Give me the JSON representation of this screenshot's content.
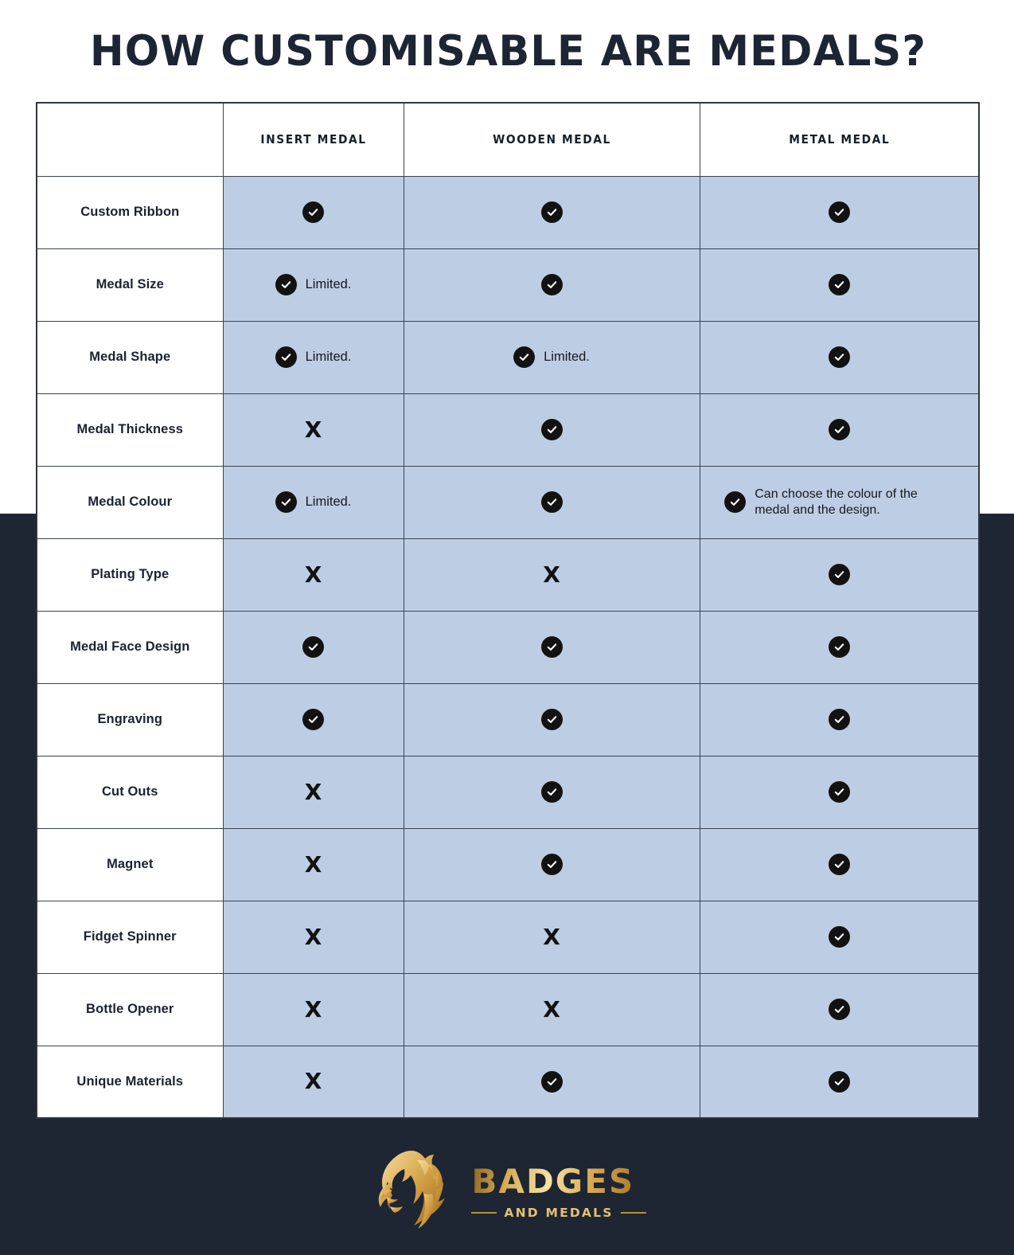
{
  "page": {
    "title": "HOW CUSTOMISABLE ARE MEDALS?",
    "background_light": "#ffffff",
    "background_dark": "#1e2533",
    "cell_highlight": "#bdcee4",
    "accent_gold": "#d8ab52"
  },
  "table": {
    "headers": {
      "label_col": "",
      "columns": [
        "INSERT MEDAL",
        "WOODEN MEDAL",
        "METAL MEDAL"
      ]
    },
    "rows": [
      {
        "label": "Custom Ribbon",
        "cells": [
          {
            "icon": "check-icon",
            "note": ""
          },
          {
            "icon": "check-icon",
            "note": ""
          },
          {
            "icon": "check-icon",
            "note": ""
          }
        ]
      },
      {
        "label": "Medal Size",
        "cells": [
          {
            "icon": "check-icon",
            "note": "Limited."
          },
          {
            "icon": "check-icon",
            "note": ""
          },
          {
            "icon": "check-icon",
            "note": ""
          }
        ]
      },
      {
        "label": "Medal Shape",
        "cells": [
          {
            "icon": "check-icon",
            "note": "Limited."
          },
          {
            "icon": "check-icon",
            "note": "Limited."
          },
          {
            "icon": "check-icon",
            "note": ""
          }
        ]
      },
      {
        "label": "Medal Thickness",
        "cells": [
          {
            "icon": "x-icon",
            "note": ""
          },
          {
            "icon": "check-icon",
            "note": ""
          },
          {
            "icon": "check-icon",
            "note": ""
          }
        ]
      },
      {
        "label": "Medal Colour",
        "cells": [
          {
            "icon": "check-icon",
            "note": "Limited."
          },
          {
            "icon": "check-icon",
            "note": ""
          },
          {
            "icon": "check-icon",
            "note": "Can choose the colour of the medal and the design."
          }
        ]
      },
      {
        "label": "Plating Type",
        "cells": [
          {
            "icon": "x-icon",
            "note": ""
          },
          {
            "icon": "x-icon",
            "note": ""
          },
          {
            "icon": "check-icon",
            "note": ""
          }
        ]
      },
      {
        "label": "Medal Face Design",
        "cells": [
          {
            "icon": "check-icon",
            "note": ""
          },
          {
            "icon": "check-icon",
            "note": ""
          },
          {
            "icon": "check-icon",
            "note": ""
          }
        ]
      },
      {
        "label": "Engraving",
        "cells": [
          {
            "icon": "check-icon",
            "note": ""
          },
          {
            "icon": "check-icon",
            "note": ""
          },
          {
            "icon": "check-icon",
            "note": ""
          }
        ]
      },
      {
        "label": "Cut Outs",
        "cells": [
          {
            "icon": "x-icon",
            "note": ""
          },
          {
            "icon": "check-icon",
            "note": ""
          },
          {
            "icon": "check-icon",
            "note": ""
          }
        ]
      },
      {
        "label": "Magnet",
        "cells": [
          {
            "icon": "x-icon",
            "note": ""
          },
          {
            "icon": "check-icon",
            "note": ""
          },
          {
            "icon": "check-icon",
            "note": ""
          }
        ]
      },
      {
        "label": "Fidget Spinner",
        "cells": [
          {
            "icon": "x-icon",
            "note": ""
          },
          {
            "icon": "x-icon",
            "note": ""
          },
          {
            "icon": "check-icon",
            "note": ""
          }
        ]
      },
      {
        "label": "Bottle Opener",
        "cells": [
          {
            "icon": "x-icon",
            "note": ""
          },
          {
            "icon": "x-icon",
            "note": ""
          },
          {
            "icon": "check-icon",
            "note": ""
          }
        ]
      },
      {
        "label": "Unique Materials",
        "cells": [
          {
            "icon": "x-icon",
            "note": ""
          },
          {
            "icon": "check-icon",
            "note": ""
          },
          {
            "icon": "check-icon",
            "note": ""
          }
        ]
      }
    ]
  },
  "footer": {
    "brand_name": "BADGES",
    "brand_tagline": "AND MEDALS",
    "logo_icon": "lion-head-icon"
  },
  "glyphs": {
    "x": "X"
  }
}
